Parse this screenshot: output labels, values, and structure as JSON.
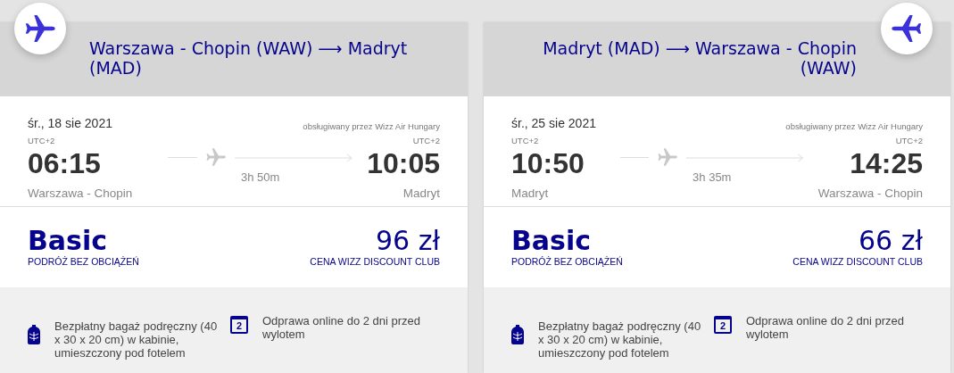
{
  "flights": [
    {
      "route": "Warszawa - Chopin (WAW) ⟶ Madryt (MAD)",
      "date": "śr., 18 sie 2021",
      "operator": "obsługiwany przez Wizz Air Hungary",
      "departure": {
        "tz": "UTC+2",
        "time": "06:15",
        "place": "Warszawa - Chopin"
      },
      "duration": "3h 50m",
      "arrival": {
        "tz": "UTC+2",
        "time": "10:05",
        "place": "Madryt"
      },
      "fare": {
        "name": "Basic",
        "subtitle": "PODRÓŻ BEZ OBCIĄŻEŃ",
        "price": "96 zł",
        "price_note": "CENA WIZZ DISCOUNT CLUB"
      },
      "features": [
        {
          "kind": "bag",
          "text": "Bezpłatny bagaż podręczny (40 x 30 x 20 cm) w kabinie, umieszczony pod fotelem"
        },
        {
          "kind": "calendar",
          "icon_text": "2",
          "text": "Odprawa online do 2 dni przed wylotem"
        }
      ]
    },
    {
      "route": "Madryt (MAD) ⟶ Warszawa - Chopin (WAW)",
      "date": "śr., 25 sie 2021",
      "operator": "obsługiwany przez Wizz Air Hungary",
      "departure": {
        "tz": "UTC+2",
        "time": "10:50",
        "place": "Madryt"
      },
      "duration": "3h 35m",
      "arrival": {
        "tz": "UTC+2",
        "time": "14:25",
        "place": "Warszawa - Chopin"
      },
      "fare": {
        "name": "Basic",
        "subtitle": "PODRÓŻ BEZ OBCIĄŻEŃ",
        "price": "66 zł",
        "price_note": "CENA WIZZ DISCOUNT CLUB"
      },
      "features": [
        {
          "kind": "bag",
          "text": "Bezpłatny bagaż podręczny (40 x 30 x 20 cm) w kabinie, umieszczony pod fotelem"
        },
        {
          "kind": "calendar",
          "icon_text": "2",
          "text": "Odprawa online do 2 dni przed wylotem"
        }
      ]
    }
  ]
}
